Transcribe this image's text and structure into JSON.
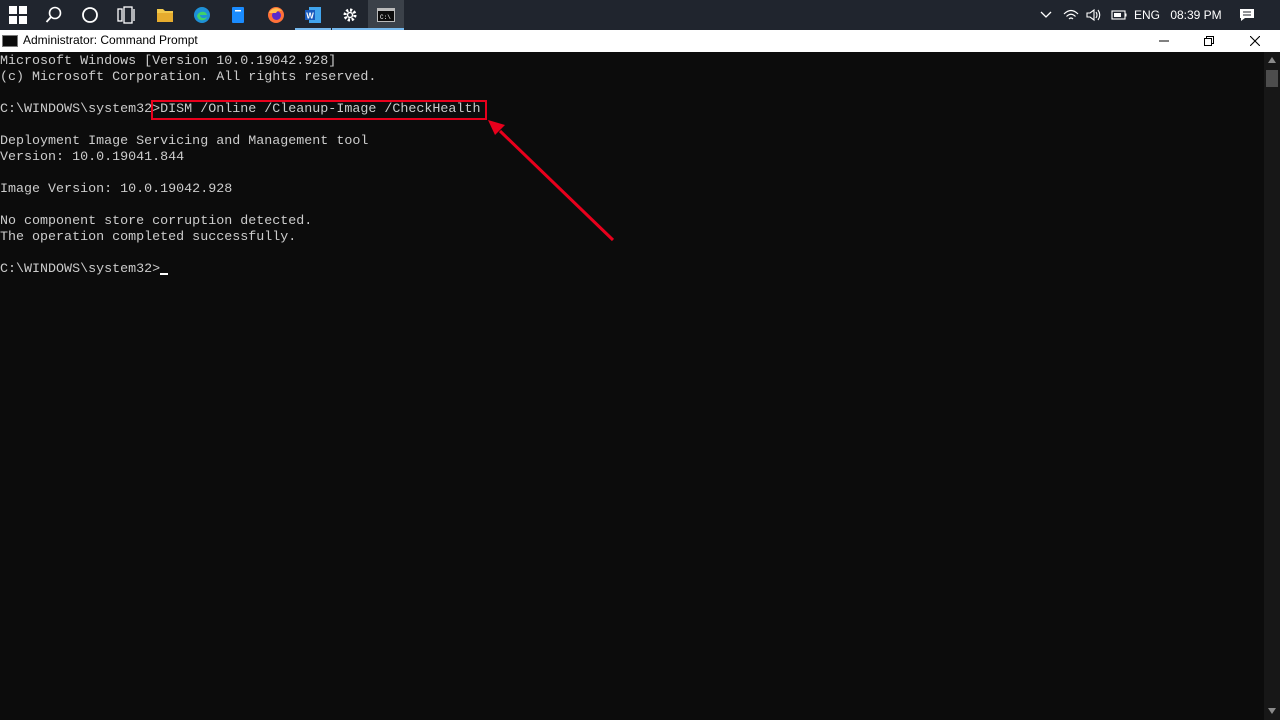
{
  "taskbar": {
    "icons": [
      "windows-start-icon",
      "search-icon",
      "cortana-icon",
      "task-view-icon",
      "file-explorer-icon",
      "edge-icon",
      "store-icon",
      "firefox-icon",
      "word-icon",
      "settings-icon",
      "command-prompt-icon"
    ],
    "tray": {
      "language": "ENG",
      "time": "08:39 PM"
    }
  },
  "window": {
    "title": "Administrator: Command Prompt"
  },
  "console": {
    "lines": [
      "Microsoft Windows [Version 10.0.19042.928]",
      "(c) Microsoft Corporation. All rights reserved.",
      "",
      "C:\\WINDOWS\\system32>DISM /Online /Cleanup-Image /CheckHealth",
      "",
      "Deployment Image Servicing and Management tool",
      "Version: 10.0.19041.844",
      "",
      "Image Version: 10.0.19042.928",
      "",
      "No component store corruption detected.",
      "The operation completed successfully.",
      "",
      "C:\\WINDOWS\\system32>"
    ]
  },
  "colors": {
    "console_bg": "#0c0c0c",
    "console_text": "#cccccc",
    "annotation": "#e8001c",
    "taskbar": "#20252e"
  }
}
